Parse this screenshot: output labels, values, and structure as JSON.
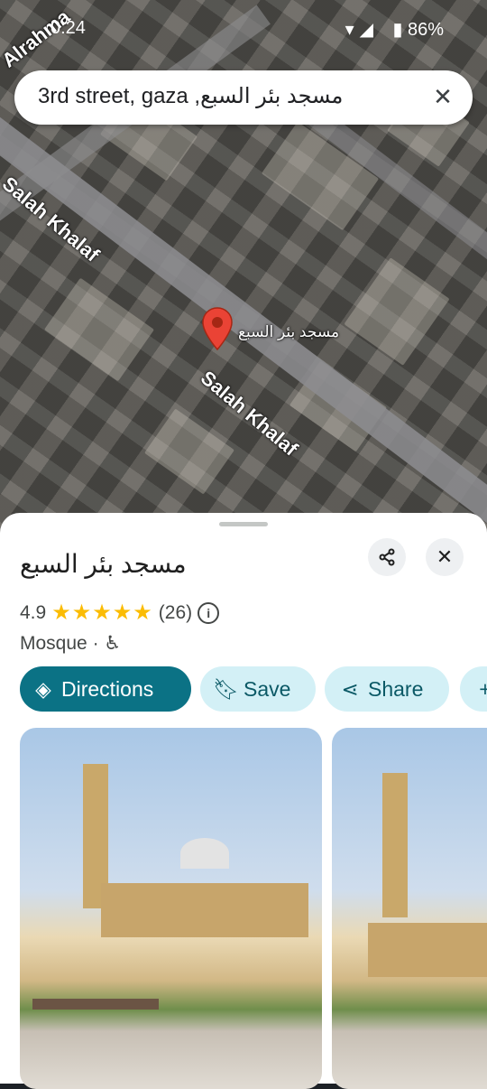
{
  "status_bar": {
    "time": "0:24",
    "battery": "86%"
  },
  "search": {
    "query": "3rd street, gaza ,مسجد بئر السبع",
    "clear_icon": "close-icon"
  },
  "map": {
    "road_label_1": "Salah Khalaf",
    "road_label_2": "Salah Khalaf",
    "road_label_top": "Alrahma",
    "pin_label": "مسجد بئر السبع",
    "pin_color": "#ea4335"
  },
  "place": {
    "name": "مسجد بئر السبع",
    "rating": "4.9",
    "stars": "★★★★★",
    "review_count": "(26)",
    "category": "Mosque",
    "separator": "·",
    "wheelchair_icon": "wheelchair-icon"
  },
  "actions": {
    "directions": "Directions",
    "save": "Save",
    "share": "Share"
  },
  "colors": {
    "accent": "#0b7285",
    "chip_bg": "#d3f0f6",
    "star": "#fbbc04"
  }
}
